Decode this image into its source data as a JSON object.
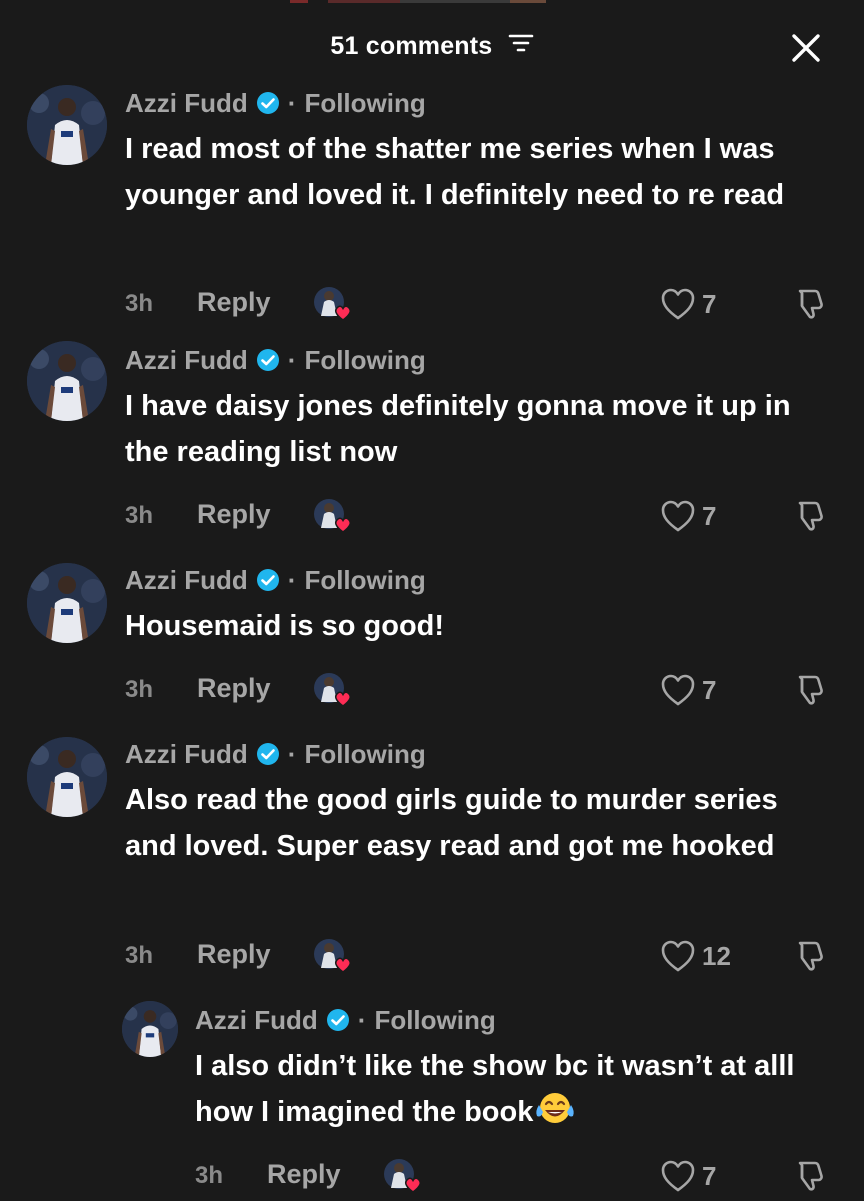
{
  "header": {
    "title": "51 comments",
    "filter_icon": "filter-lines-icon",
    "close_icon": "close-icon"
  },
  "colors": {
    "background": "#1a1a1a",
    "text_primary": "#ffffff",
    "text_secondary": "#a6a6a6",
    "verified": "#20b6ee",
    "reaction_heart": "#fe2c55"
  },
  "comments": [
    {
      "author": "Azzi Fudd",
      "relation": "Following",
      "text": "I read most of the shatter me series when I was younger and loved it. I definitely need to re read",
      "time": "3h",
      "reply_label": "Reply",
      "likes": "7"
    },
    {
      "author": "Azzi Fudd",
      "relation": "Following",
      "text": "I have daisy jones definitely gonna move it up in the reading list now",
      "time": "3h",
      "reply_label": "Reply",
      "likes": "7"
    },
    {
      "author": "Azzi Fudd",
      "relation": "Following",
      "text": "Housemaid is so good!",
      "time": "3h",
      "reply_label": "Reply",
      "likes": "7"
    },
    {
      "author": "Azzi Fudd",
      "relation": "Following",
      "text": "Also read the good girls guide to murder series and loved. Super easy read and got me hooked",
      "time": "3h",
      "reply_label": "Reply",
      "likes": "12"
    },
    {
      "author": "Azzi Fudd",
      "relation": "Following",
      "text": "I also didn’t like the show bc it wasn’t at alll how I imagined the book",
      "time": "3h",
      "reply_label": "Reply",
      "likes": "7",
      "emoji": "tears-of-joy-emoji"
    }
  ]
}
